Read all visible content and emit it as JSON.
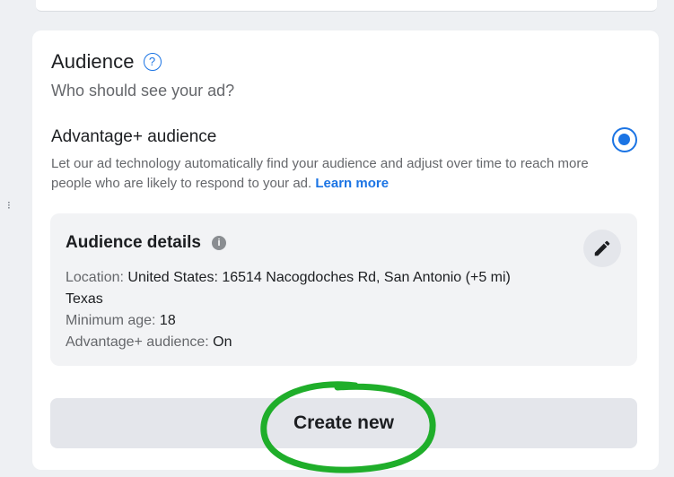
{
  "section": {
    "heading": "Audience",
    "help_icon": "question-mark",
    "subtitle": "Who should see your ad?"
  },
  "option": {
    "title": "Advantage+ audience",
    "selected": true,
    "description": "Let our ad technology automatically find your audience and adjust over time to reach more people who are likely to respond to your ad. ",
    "learn_more": "Learn more"
  },
  "details": {
    "title": "Audience details",
    "info_icon": "i",
    "edit_icon": "pencil-icon",
    "location_label": "Location: ",
    "location_value": "United States: 16514 Nacogdoches Rd, San Antonio (+5 mi)",
    "location_value_line2": "Texas",
    "min_age_label": "Minimum age: ",
    "min_age_value": "18",
    "advantage_label": "Advantage+ audience: ",
    "advantage_value": "On"
  },
  "actions": {
    "create_new": "Create new"
  },
  "colors": {
    "accent": "#1b74e4",
    "highlight": "#1fae2a"
  }
}
